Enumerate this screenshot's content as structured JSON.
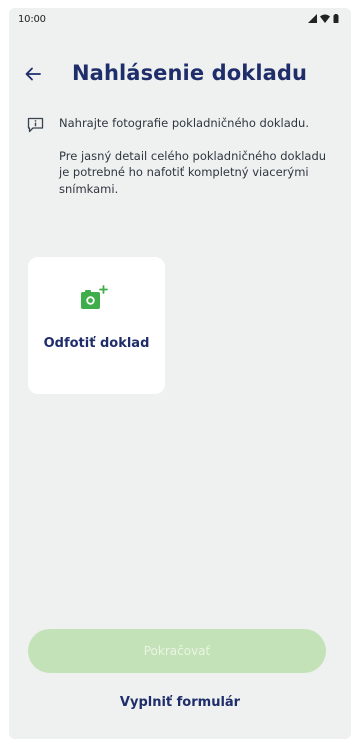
{
  "status_bar": {
    "time": "10:00",
    "icons": [
      "signal-icon",
      "wifi-icon",
      "battery-icon"
    ]
  },
  "header": {
    "back_icon": "arrow-left-icon",
    "title": "Nahlásenie dokladu"
  },
  "info": {
    "icon": "info-icon",
    "line1": "Nahrajte fotografie pokladničného dokladu.",
    "line2": "Pre jasný detail celého pokladničného dokladu je potrebné ho nafotiť kompletný viacerými snímkami."
  },
  "photo_card": {
    "icon": "add-photo-icon",
    "label": "Odfotiť doklad"
  },
  "actions": {
    "continue_label": "Pokračovať",
    "continue_enabled": false,
    "fill_form_label": "Vyplniť formulár"
  },
  "colors": {
    "title": "#1f2e6b",
    "accent_green": "#3fae4a",
    "button_disabled_bg": "#c4e2b8",
    "background": "#eef1ef"
  }
}
